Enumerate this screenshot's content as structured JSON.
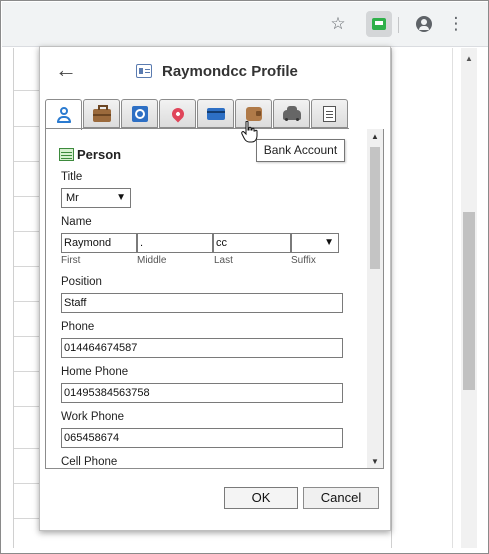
{
  "popup": {
    "title": "Raymondcc Profile",
    "tabs": [
      {
        "name": "person",
        "icon": "person-icon",
        "active": true
      },
      {
        "name": "business",
        "icon": "briefcase-icon",
        "active": false
      },
      {
        "name": "internet",
        "icon": "globe-icon",
        "active": false
      },
      {
        "name": "address",
        "icon": "location-pin-icon",
        "active": false
      },
      {
        "name": "credit-card",
        "icon": "credit-card-icon",
        "active": false
      },
      {
        "name": "bank-account",
        "icon": "wallet-icon",
        "active": false
      },
      {
        "name": "car",
        "icon": "car-icon",
        "active": false
      },
      {
        "name": "notes",
        "icon": "note-icon",
        "active": false
      }
    ],
    "tooltip": "Bank Account",
    "section_title": "Person",
    "form": {
      "title_label": "Title",
      "title_value": "Mr",
      "name_label": "Name",
      "first_value": "Raymond",
      "middle_value": ".",
      "last_value": "cc",
      "suffix_value": "",
      "first_sublabel": "First",
      "middle_sublabel": "Middle",
      "last_sublabel": "Last",
      "suffix_sublabel": "Suffix",
      "position_label": "Position",
      "position_value": "Staff",
      "phone_label": "Phone",
      "phone_value": "014464674587",
      "home_phone_label": "Home Phone",
      "home_phone_value": "01495384563758",
      "work_phone_label": "Work Phone",
      "work_phone_value": "065458674",
      "cell_phone_label": "Cell Phone"
    },
    "ok_label": "OK",
    "cancel_label": "Cancel"
  },
  "browser": {
    "toolbar_icons": [
      "star-icon",
      "extension-icon",
      "account-icon",
      "more-menu-icon"
    ],
    "accent": "#2b7bd0"
  }
}
